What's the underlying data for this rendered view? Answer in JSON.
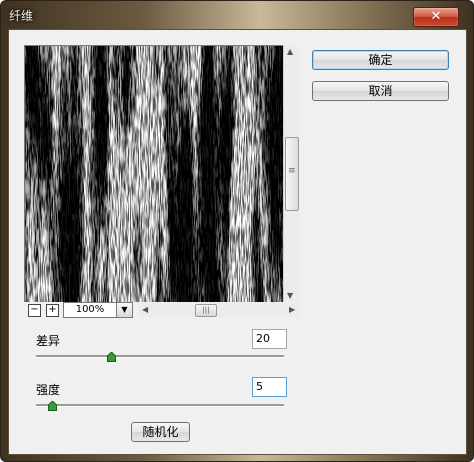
{
  "window": {
    "title": "纤维",
    "close_symbol": "✕"
  },
  "buttons": {
    "ok": "确定",
    "cancel": "取消",
    "randomize": "随机化"
  },
  "preview": {
    "zoom": "100%",
    "zoom_out": "−",
    "zoom_in": "+",
    "thumb_grip": "|||",
    "grip": "≡"
  },
  "params": {
    "variance": {
      "label": "差异",
      "value": "20",
      "min": 1,
      "max": 64,
      "level": 20
    },
    "strength": {
      "label": "强度",
      "value": "5",
      "min": 1,
      "max": 64,
      "level": 5
    }
  },
  "colors": {
    "accent": "#3c7fb1",
    "slider_thumb": "#3a9a3a"
  }
}
